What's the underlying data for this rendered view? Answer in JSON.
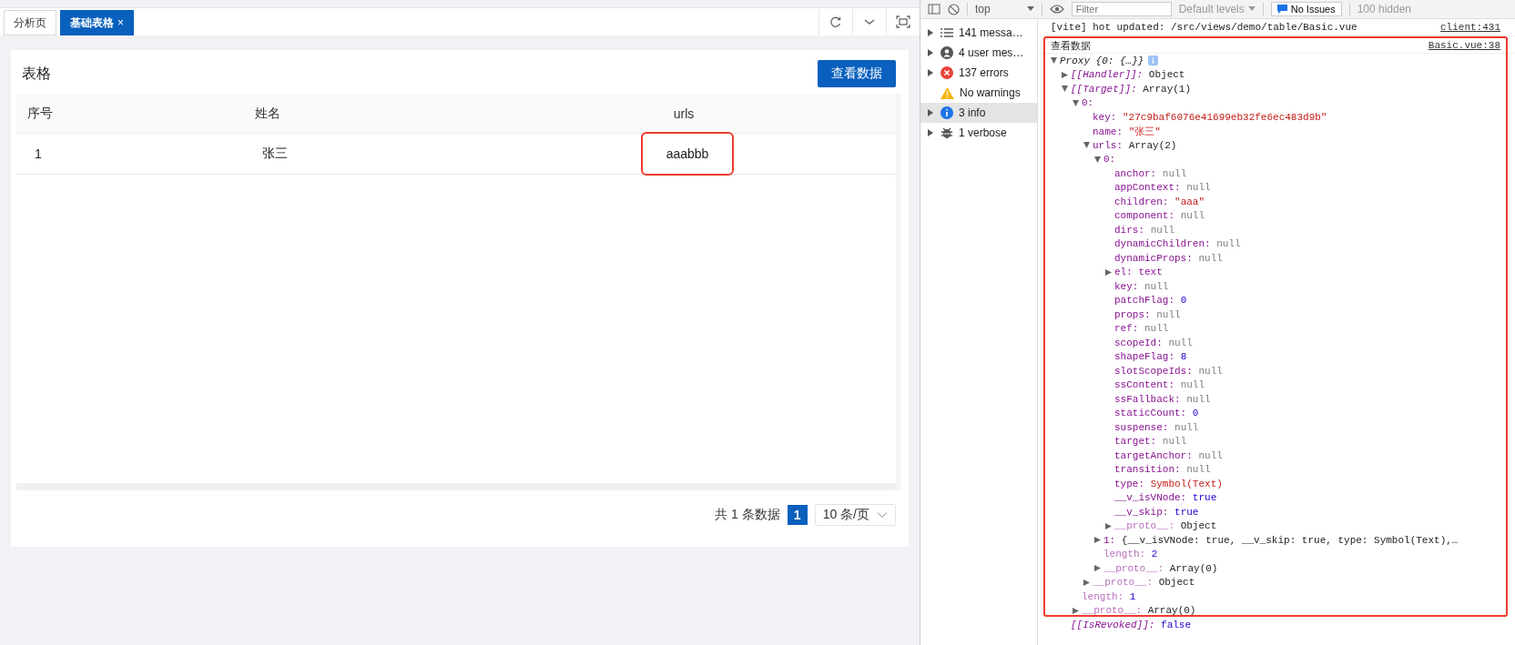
{
  "tabs": [
    {
      "label": "分析页",
      "selected": false
    },
    {
      "label": "基础表格",
      "selected": true,
      "close": "×"
    }
  ],
  "card": {
    "title": "表格",
    "button": "查看数据",
    "table": {
      "columns": [
        "序号",
        "姓名",
        "urls"
      ],
      "rows": [
        {
          "cells": [
            {
              "text": "1",
              "highlighted": false
            },
            {
              "text": "张三",
              "highlighted": false
            },
            {
              "text": "aaabbb",
              "highlighted": true
            }
          ]
        }
      ]
    },
    "pagination": {
      "total": "共 1 条数据",
      "pages": [
        {
          "label": "1",
          "selected": true
        }
      ],
      "page_size": "10 条/页"
    }
  },
  "devtools": {
    "toolbar": {
      "context": "top",
      "filter_placeholder": "Filter",
      "levels": "Default levels",
      "issues": "No Issues",
      "hidden": "100 hidden"
    },
    "sidebar": [
      {
        "label": "141 messa…",
        "kind": "messages",
        "expandable": true,
        "selected": false
      },
      {
        "label": "4 user mes…",
        "kind": "user",
        "expandable": true,
        "selected": false
      },
      {
        "label": "137 errors",
        "kind": "errors",
        "expandable": true,
        "selected": false
      },
      {
        "label": "No warnings",
        "kind": "warnings",
        "expandable": false,
        "selected": false
      },
      {
        "label": "3 info",
        "kind": "info",
        "expandable": true,
        "selected": true
      },
      {
        "label": "1 verbose",
        "kind": "verbose",
        "expandable": true,
        "selected": false
      }
    ],
    "logs": [
      {
        "kind": "text",
        "text": "[vite] hot updated: /src/views/demo/table/Basic.vue",
        "source": "client:431",
        "highlighted": false
      },
      {
        "kind": "object",
        "text": "查看数据",
        "source": "Basic.vue:38",
        "highlighted": true,
        "tree": {
          "summary": "Proxy {0: {…}}",
          "expanded": true,
          "children": [
            {
              "kind": "internal",
              "key": "[[Handler]]:",
              "value": {
                "text": "Object",
                "kind": "object"
              },
              "expanded": false
            },
            {
              "kind": "internal",
              "key": "[[Target]]:",
              "value": {
                "text": "Array(1)",
                "kind": "object"
              },
              "expanded": true,
              "children": [
                {
                  "kind": "own",
                  "key": "0:",
                  "expanded": true,
                  "children": [
                    {
                      "kind": "own",
                      "key": "key:",
                      "value": {
                        "text": "\"27c9baf6076e41699eb32fe6ec483d9b\"",
                        "kind": "string"
                      }
                    },
                    {
                      "kind": "own",
                      "key": "name:",
                      "value": {
                        "text": "\"张三\"",
                        "kind": "string"
                      }
                    },
                    {
                      "kind": "own",
                      "key": "urls:",
                      "value": {
                        "text": "Array(2)",
                        "kind": "object"
                      },
                      "expanded": true,
                      "children": [
                        {
                          "kind": "own",
                          "key": "0:",
                          "expanded": true,
                          "children": [
                            {
                              "kind": "own",
                              "key": "anchor:",
                              "value": {
                                "text": "null",
                                "kind": "null"
                              }
                            },
                            {
                              "kind": "own",
                              "key": "appContext:",
                              "value": {
                                "text": "null",
                                "kind": "null"
                              }
                            },
                            {
                              "kind": "own",
                              "key": "children:",
                              "value": {
                                "text": "\"aaa\"",
                                "kind": "string"
                              }
                            },
                            {
                              "kind": "own",
                              "key": "component:",
                              "value": {
                                "text": "null",
                                "kind": "null"
                              }
                            },
                            {
                              "kind": "own",
                              "key": "dirs:",
                              "value": {
                                "text": "null",
                                "kind": "null"
                              }
                            },
                            {
                              "kind": "own",
                              "key": "dynamicChildren:",
                              "value": {
                                "text": "null",
                                "kind": "null"
                              }
                            },
                            {
                              "kind": "own",
                              "key": "dynamicProps:",
                              "value": {
                                "text": "null",
                                "kind": "null"
                              }
                            },
                            {
                              "kind": "own",
                              "key": "el:",
                              "value": {
                                "text": "text",
                                "kind": "node"
                              },
                              "expanded": false
                            },
                            {
                              "kind": "own",
                              "key": "key:",
                              "value": {
                                "text": "null",
                                "kind": "null"
                              }
                            },
                            {
                              "kind": "own",
                              "key": "patchFlag:",
                              "value": {
                                "text": "0",
                                "kind": "number"
                              }
                            },
                            {
                              "kind": "own",
                              "key": "props:",
                              "value": {
                                "text": "null",
                                "kind": "null"
                              }
                            },
                            {
                              "kind": "own",
                              "key": "ref:",
                              "value": {
                                "text": "null",
                                "kind": "null"
                              }
                            },
                            {
                              "kind": "own",
                              "key": "scopeId:",
                              "value": {
                                "text": "null",
                                "kind": "null"
                              }
                            },
                            {
                              "kind": "own",
                              "key": "shapeFlag:",
                              "value": {
                                "text": "8",
                                "kind": "number"
                              }
                            },
                            {
                              "kind": "own",
                              "key": "slotScopeIds:",
                              "value": {
                                "text": "null",
                                "kind": "null"
                              }
                            },
                            {
                              "kind": "own",
                              "key": "ssContent:",
                              "value": {
                                "text": "null",
                                "kind": "null"
                              }
                            },
                            {
                              "kind": "own",
                              "key": "ssFallback:",
                              "value": {
                                "text": "null",
                                "kind": "null"
                              }
                            },
                            {
                              "kind": "own",
                              "key": "staticCount:",
                              "value": {
                                "text": "0",
                                "kind": "number"
                              }
                            },
                            {
                              "kind": "own",
                              "key": "suspense:",
                              "value": {
                                "text": "null",
                                "kind": "null"
                              }
                            },
                            {
                              "kind": "own",
                              "key": "target:",
                              "value": {
                                "text": "null",
                                "kind": "null"
                              }
                            },
                            {
                              "kind": "own",
                              "key": "targetAnchor:",
                              "value": {
                                "text": "null",
                                "kind": "null"
                              }
                            },
                            {
                              "kind": "own",
                              "key": "transition:",
                              "value": {
                                "text": "null",
                                "kind": "null"
                              }
                            },
                            {
                              "kind": "own",
                              "key": "type:",
                              "value": {
                                "text": "Symbol(Text)",
                                "kind": "string"
                              }
                            },
                            {
                              "kind": "own",
                              "key": "__v_isVNode:",
                              "value": {
                                "text": "true",
                                "kind": "number"
                              }
                            },
                            {
                              "kind": "own",
                              "key": "__v_skip:",
                              "value": {
                                "text": "true",
                                "kind": "number"
                              }
                            },
                            {
                              "kind": "inherited",
                              "key": "__proto__:",
                              "value": {
                                "text": "Object",
                                "kind": "object"
                              },
                              "expanded": false
                            }
                          ]
                        },
                        {
                          "kind": "own",
                          "key": "1:",
                          "value": {
                            "text": "{__v_isVNode: true, __v_skip: true, type: Symbol(Text),…",
                            "kind": "object"
                          },
                          "expanded": false
                        },
                        {
                          "kind": "inherited",
                          "key": "length:",
                          "value": {
                            "text": "2",
                            "kind": "number"
                          }
                        },
                        {
                          "kind": "inherited",
                          "key": "__proto__:",
                          "value": {
                            "text": "Array(0)",
                            "kind": "object"
                          },
                          "expanded": false
                        }
                      ]
                    },
                    {
                      "kind": "inherited",
                      "key": "__proto__:",
                      "value": {
                        "text": "Object",
                        "kind": "object"
                      },
                      "expanded": false
                    }
                  ]
                },
                {
                  "kind": "inherited",
                  "key": "length:",
                  "value": {
                    "text": "1",
                    "kind": "number"
                  }
                },
                {
                  "kind": "inherited",
                  "key": "__proto__:",
                  "value": {
                    "text": "Array(0)",
                    "kind": "object"
                  },
                  "expanded": false
                }
              ]
            },
            {
              "kind": "internal",
              "key": "[[IsRevoked]]:",
              "value": {
                "text": "false",
                "kind": "number"
              }
            }
          ]
        }
      }
    ]
  }
}
